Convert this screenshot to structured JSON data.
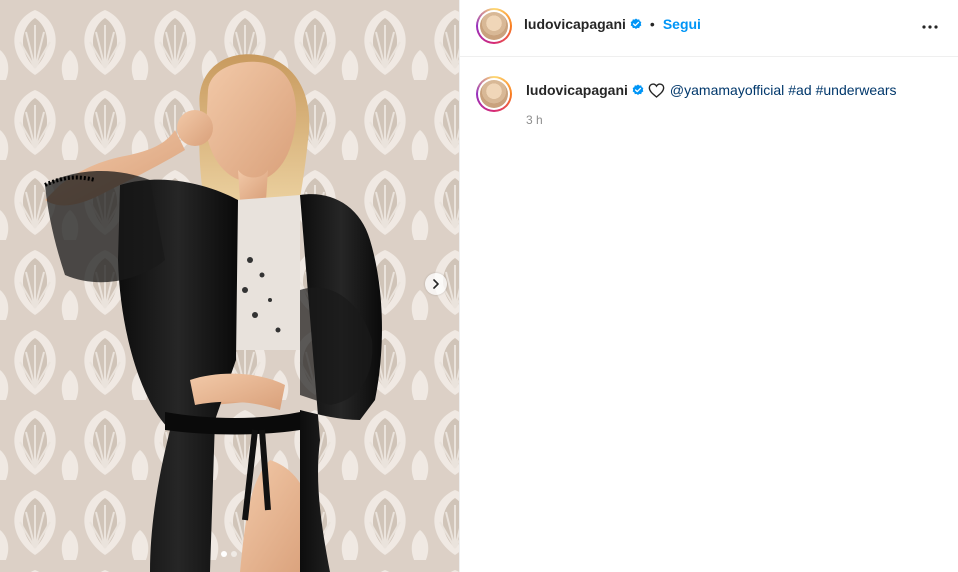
{
  "post": {
    "username": "ludovicapagani",
    "follow_label": "Segui",
    "separator": "•",
    "caption": {
      "mention": "@yamamayofficial",
      "hashtags": [
        "#ad",
        "#underwears"
      ]
    },
    "timestamp": "3 h",
    "carousel": {
      "total": 2,
      "current": 1
    }
  },
  "icons": {
    "verified": "verified-badge-icon",
    "heart": "heart-emoji-icon",
    "more": "more-options-icon",
    "next": "chevron-right-icon"
  },
  "colors": {
    "link": "#00376b",
    "follow": "#0095f6",
    "verified": "#0095f6",
    "muted": "#8e8e8e"
  }
}
